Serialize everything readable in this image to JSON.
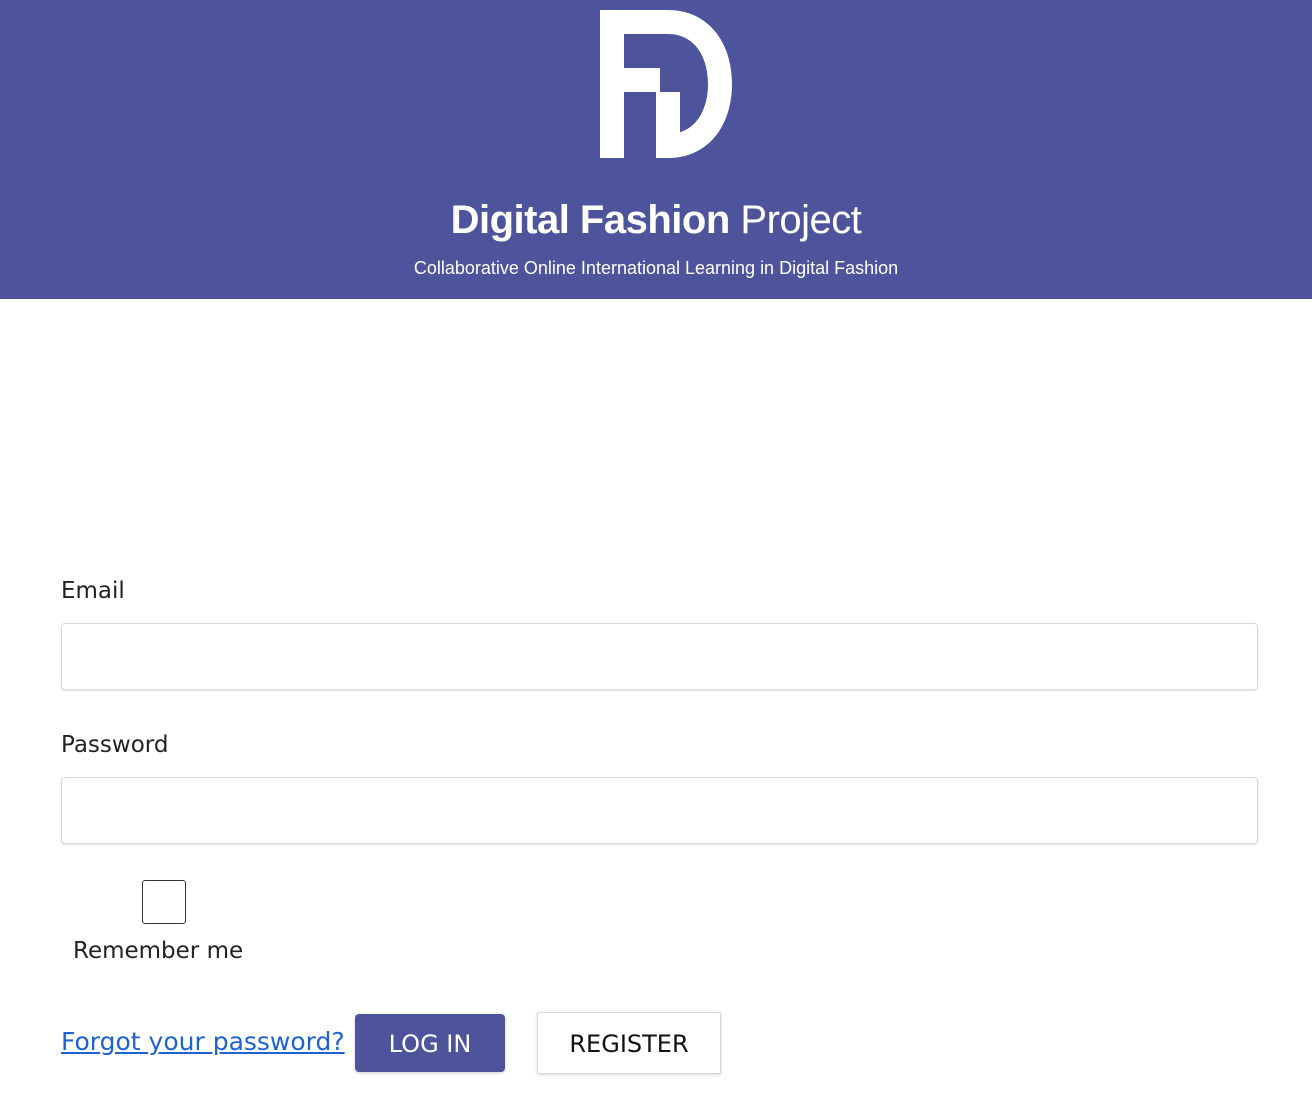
{
  "header": {
    "background_color": "#4d549b",
    "logo_icon": "fd-monogram-logo",
    "brand_strong": "Digital Fashion",
    "brand_light": "Project",
    "tagline": "Collaborative Online International Learning in Digital Fashion"
  },
  "form": {
    "email_label": "Email",
    "email_value": "",
    "password_label": "Password",
    "password_value": "",
    "remember_label": "Remember me",
    "remember_checked": false,
    "forgot_link": "Forgot your password? ",
    "login_button": "LOG IN",
    "register_button": "REGISTER",
    "accent_color": "#4d549b",
    "link_color": "#1e62d0"
  }
}
